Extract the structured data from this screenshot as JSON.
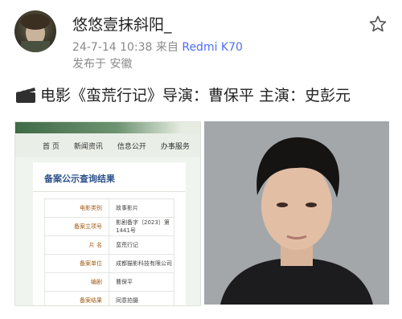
{
  "user": {
    "name": "悠悠壹抹斜阳_",
    "avatar_icon": "avatar"
  },
  "post": {
    "time": "24-7-14 10:38",
    "source_prefix": "来自",
    "source": "Redmi K70",
    "location": "发布于 安徽",
    "clap_icon": "clapperboard-icon",
    "text": "电影《蛮荒行记》导演：曹保平 主演：史彭元"
  },
  "actions": {
    "favorite_icon": "star-icon"
  },
  "screenshot": {
    "nav": [
      "首 页",
      "新闻资讯",
      "信息公开",
      "办事服务"
    ],
    "title": "备案公示查询结果",
    "rows": [
      {
        "k": "电影类别",
        "v": "故事影片"
      },
      {
        "k": "备案立项号",
        "v": "影剧备字〔2023〕第1441号"
      },
      {
        "k": "片  名",
        "v": "蛮荒行记"
      },
      {
        "k": "备案单位",
        "v": "成都猫影科技有限公司"
      },
      {
        "k": "编剧",
        "v": "曹保平"
      },
      {
        "k": "备案结果",
        "v": "同意拍摄"
      }
    ]
  },
  "colors": {
    "accent": "#4e6ef2",
    "text": "#222222",
    "meta": "#8a8a8a"
  }
}
